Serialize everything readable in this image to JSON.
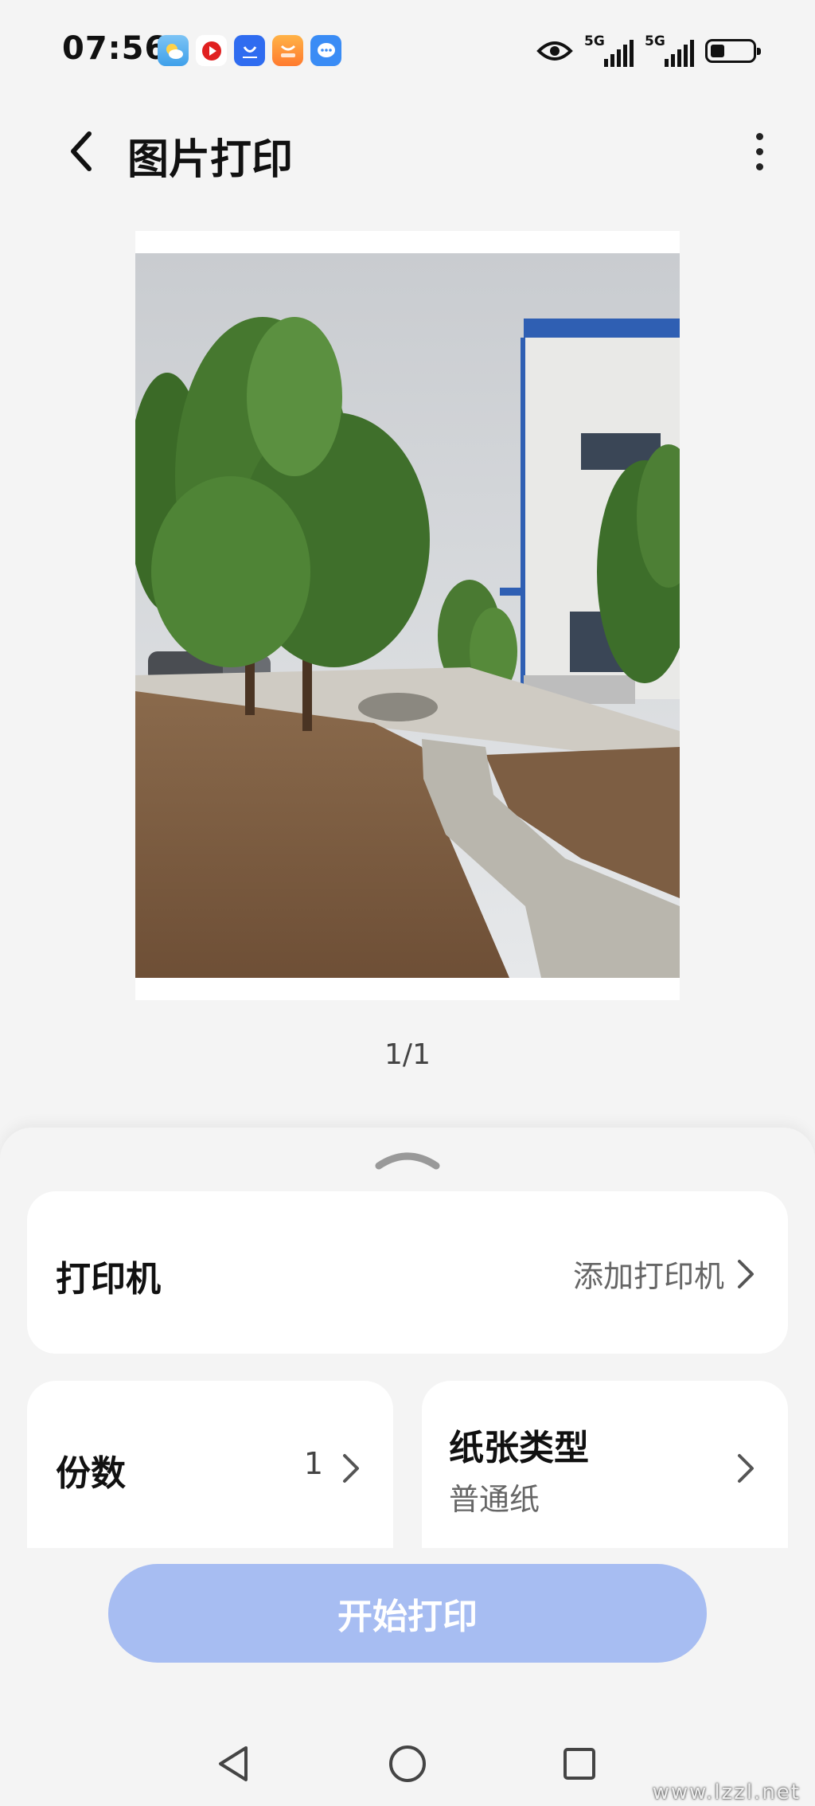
{
  "status_bar": {
    "time": "07:56",
    "signal_1": "5G",
    "signal_2": "5G",
    "notification_icons": [
      "weather-icon",
      "video-icon",
      "honor-store-icon",
      "mall-icon",
      "message-icon"
    ]
  },
  "header": {
    "title": "图片打印"
  },
  "preview": {
    "page_indicator": "1/1"
  },
  "printer_card": {
    "label": "打印机",
    "value": "添加打印机"
  },
  "copies_card": {
    "label": "份数",
    "value": "1"
  },
  "paper_card": {
    "label": "纸张类型",
    "value": "普通纸"
  },
  "actions": {
    "start_label": "开始打印"
  },
  "watermark": "www.lzzl.net",
  "colors": {
    "accent_disabled": "#a7bdf2",
    "background": "#f4f4f4",
    "card": "#ffffff"
  }
}
